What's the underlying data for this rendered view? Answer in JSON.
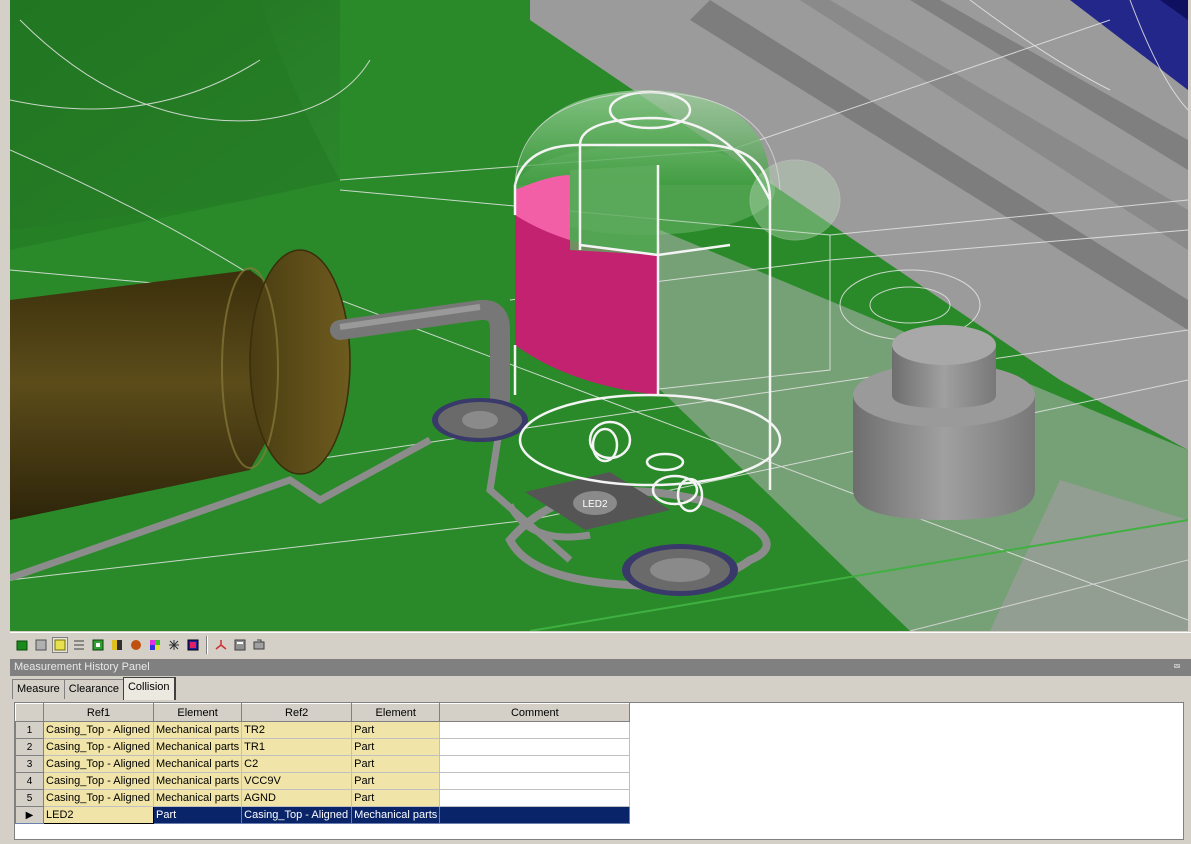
{
  "viewport": {
    "board_label": "LED2",
    "colors": {
      "board": "#2a8a2a",
      "casing": "#9a9a9a",
      "collision": "#d6217f",
      "capacitor": "#4d3f12"
    }
  },
  "toolbar": {
    "icons": [
      "board-icon",
      "layer-icon",
      "parts-icon",
      "wire-icon",
      "grid-icon",
      "color-icon",
      "component-icon",
      "palette-icon",
      "light-icon",
      "view-icon",
      "axis-icon",
      "calculator-icon",
      "settings-icon"
    ]
  },
  "panel": {
    "title": "Measurement History Panel",
    "pin_glyph": "⮹"
  },
  "tabs": [
    {
      "label": "Measure"
    },
    {
      "label": "Clearance"
    },
    {
      "label": "Collision"
    }
  ],
  "grid": {
    "headers": [
      "Ref1",
      "Element",
      "Ref2",
      "Element",
      "Comment"
    ],
    "rows": [
      {
        "n": "1",
        "ref1": "Casing_Top - Aligned",
        "el1": "Mechanical parts",
        "ref2": "TR2",
        "el2": "Part",
        "comment": ""
      },
      {
        "n": "2",
        "ref1": "Casing_Top - Aligned",
        "el1": "Mechanical parts",
        "ref2": "TR1",
        "el2": "Part",
        "comment": ""
      },
      {
        "n": "3",
        "ref1": "Casing_Top - Aligned",
        "el1": "Mechanical parts",
        "ref2": "C2",
        "el2": "Part",
        "comment": ""
      },
      {
        "n": "4",
        "ref1": "Casing_Top - Aligned",
        "el1": "Mechanical parts",
        "ref2": "VCC9V",
        "el2": "Part",
        "comment": ""
      },
      {
        "n": "5",
        "ref1": "Casing_Top - Aligned",
        "el1": "Mechanical parts",
        "ref2": "AGND",
        "el2": "Part",
        "comment": ""
      }
    ],
    "new_row": {
      "marker": "▶",
      "ref1": "LED2",
      "el1": "Part",
      "ref2": "Casing_Top - Aligned",
      "el2": "Mechanical parts",
      "comment": ""
    }
  }
}
